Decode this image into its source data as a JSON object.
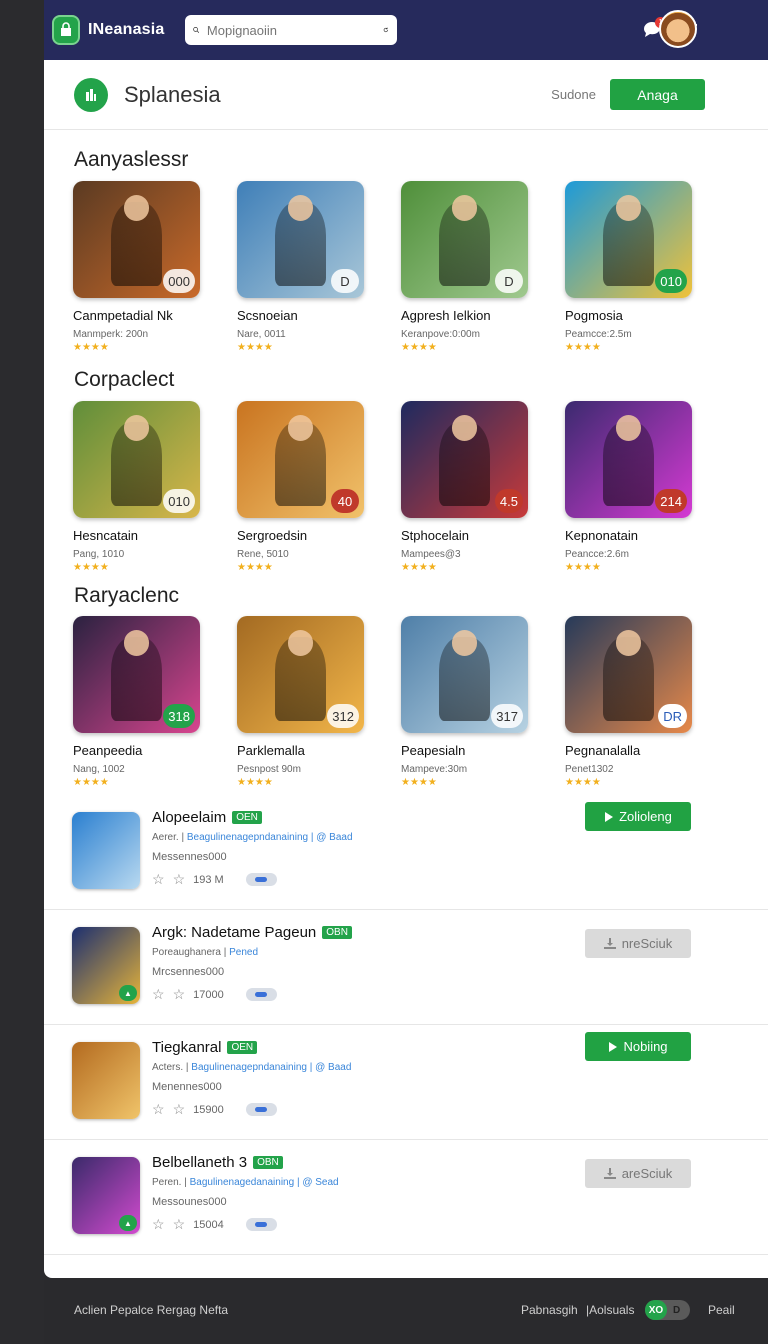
{
  "topbar": {
    "app_name": "INeanasia",
    "search_placeholder": "Mopignaoiin",
    "notification_count": "1"
  },
  "header": {
    "title": "Splanesia",
    "link": "Sudone",
    "button": "Anaga"
  },
  "sections": [
    {
      "title": "Aanyaslessr",
      "cards": [
        {
          "title": "Canmpetadial Nk",
          "sub": "Manmperk: 200n",
          "badge": "000",
          "colors": [
            "#5a3a22",
            "#c96a2a"
          ],
          "badge_style": "light"
        },
        {
          "title": "Scsnoeian",
          "sub": "Nare, 0011",
          "badge": "D",
          "colors": [
            "#3f7fb8",
            "#a9c7d8"
          ],
          "badge_style": "light"
        },
        {
          "title": "Agpresh Ielkion",
          "sub": "Keranpove:0:00m",
          "badge": "D",
          "colors": [
            "#4f8f3a",
            "#a0c98f"
          ],
          "badge_style": "light"
        },
        {
          "title": "Pogmosia",
          "sub": "Peamcce:2.5m",
          "badge": "010",
          "colors": [
            "#1d9ad9",
            "#f0c23a"
          ],
          "badge_style": "green"
        }
      ]
    },
    {
      "title": "Corpaclect",
      "cards": [
        {
          "title": "Hesncatain",
          "sub": "Pang, 1010",
          "badge": "010",
          "colors": [
            "#5f8e3a",
            "#d8b64a"
          ],
          "badge_style": "light"
        },
        {
          "title": "Sergroedsin",
          "sub": "Rene, 5010",
          "badge": "40",
          "colors": [
            "#c97420",
            "#f1c26b"
          ],
          "badge_style": "red"
        },
        {
          "title": "Stphocelain",
          "sub": "Mampees@3",
          "badge": "4.5",
          "colors": [
            "#1e2a5f",
            "#c83a3a"
          ],
          "badge_style": "red"
        },
        {
          "title": "Kepnonatain",
          "sub": "Peancce:2.6m",
          "badge": "214",
          "colors": [
            "#3b2a6f",
            "#d53ad3"
          ],
          "badge_style": "red"
        }
      ]
    },
    {
      "title": "Raryaclenc",
      "cards": [
        {
          "title": "Peanpeedia",
          "sub": "Nang, 1002",
          "badge": "318",
          "colors": [
            "#2a2240",
            "#d8458f"
          ],
          "badge_style": "green"
        },
        {
          "title": "Parklemalla",
          "sub": "Pesnpost 90m",
          "badge": "312",
          "colors": [
            "#a36a22",
            "#f2b64a"
          ],
          "badge_style": "light"
        },
        {
          "title": "Peapesialn",
          "sub": "Mampeve:30m",
          "badge": "317",
          "colors": [
            "#4f7fa8",
            "#b7d2e2"
          ],
          "badge_style": "light"
        },
        {
          "title": "Pegnanalalla",
          "sub": "Penet1302",
          "badge": "DR",
          "colors": [
            "#263a5a",
            "#e7894a"
          ],
          "badge_style": "white"
        }
      ]
    }
  ],
  "list": [
    {
      "title": "Alopeelaim",
      "tag": "OEN",
      "meta_prefix": "Aerer. | ",
      "meta_link": "Beagulinenagepndanaining",
      "meta_suffix": " | @ Baad",
      "size": "Messennes000",
      "rating": "193 M",
      "action": "Zolioleng",
      "action_style": "green",
      "colors": [
        "#2a7fd0",
        "#b9d9f0"
      ]
    },
    {
      "title": "Argk: Nadetame Pageun",
      "tag": "OBN",
      "meta_prefix": "Poreaughanera | ",
      "meta_link": "Pened",
      "meta_suffix": "",
      "size": "Mrcsennes000",
      "rating": "17000",
      "action": "nreSciuk",
      "action_style": "grey",
      "colors": [
        "#1c2f70",
        "#e6b43a"
      ]
    },
    {
      "title": "Tiegkanral",
      "tag": "OEN",
      "meta_prefix": "Acters. | ",
      "meta_link": "Bagulinenagepndanaining",
      "meta_suffix": " | @ Baad",
      "size": "Menennes000",
      "rating": "15900",
      "action": "Nobiing",
      "action_style": "green",
      "colors": [
        "#b36a1f",
        "#f0c46a"
      ]
    },
    {
      "title": "Belbellaneth 3",
      "tag": "OBN",
      "meta_prefix": "Peren. | ",
      "meta_link": "Bagulinenagedanaining",
      "meta_suffix": " | @ Sead",
      "size": "Messounes000",
      "rating": "15004",
      "action": "areSciuk",
      "action_style": "grey",
      "colors": [
        "#3a2a6a",
        "#d24bcf"
      ]
    }
  ],
  "footer": {
    "left": "Aclien Pepalce Rergag Nefta",
    "right1": "Pabnasgih",
    "right2": "|Aolsuals",
    "toggle_on": "XO",
    "toggle_off": "D",
    "right3": "Peail"
  }
}
